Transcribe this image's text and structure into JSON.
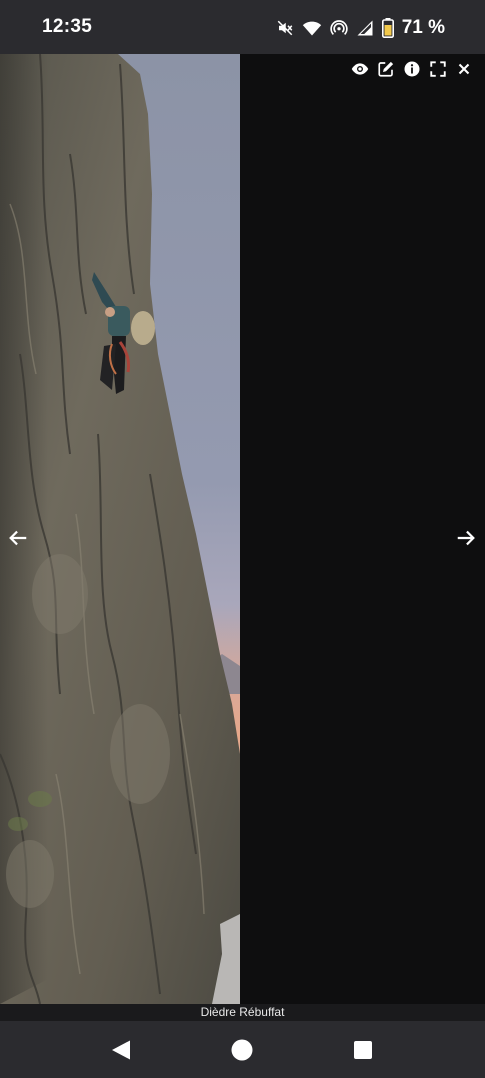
{
  "status_bar": {
    "time": "12:35",
    "battery_percent": "71 %",
    "icons": [
      "mute-icon",
      "wifi-icon",
      "hotspot-icon",
      "signal-icon",
      "battery-icon"
    ]
  },
  "viewer": {
    "caption": "Dièdre Rébuffat",
    "toolbar": [
      "eye-icon",
      "edit-icon",
      "info-icon",
      "fullscreen-icon",
      "close-icon"
    ],
    "prev_icon": "arrow-left-icon",
    "next_icon": "arrow-right-icon",
    "colors": {
      "background": "#0e0e0f",
      "rock": "#6f6a5d",
      "sky_top": "#8c93a6",
      "sky_dusk": "#e7a88a"
    }
  },
  "nav_bar": {
    "buttons": [
      "back-icon",
      "home-icon",
      "recents-icon"
    ]
  }
}
